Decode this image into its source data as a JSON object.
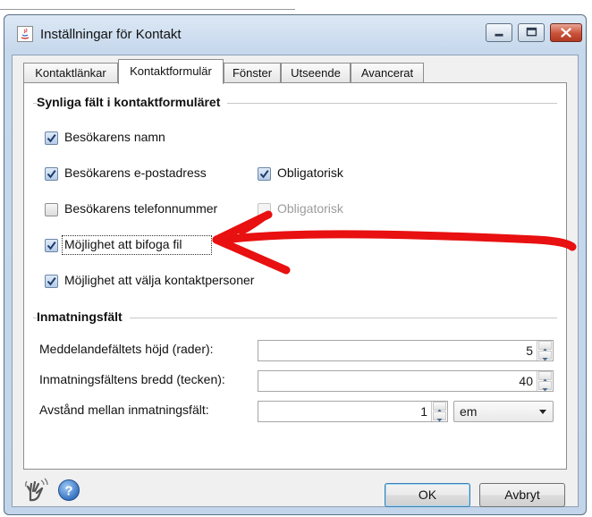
{
  "window": {
    "title": "Inställningar för Kontakt"
  },
  "tabs": [
    {
      "label": "Kontaktlänkar",
      "active": false
    },
    {
      "label": "Kontaktformulär",
      "active": true
    },
    {
      "label": "Fönster",
      "active": false
    },
    {
      "label": "Utseende",
      "active": false
    },
    {
      "label": "Avancerat",
      "active": false
    }
  ],
  "visible_fields": {
    "title": "Synliga fält i kontaktformuläret",
    "items": [
      {
        "label": "Besökarens namn",
        "checked": true
      },
      {
        "label": "Besökarens e-postadress",
        "checked": true,
        "required_label": "Obligatorisk",
        "required_checked": true,
        "required_enabled": true
      },
      {
        "label": "Besökarens telefonnummer",
        "checked": false,
        "required_label": "Obligatorisk",
        "required_checked": false,
        "required_enabled": false
      },
      {
        "label": "Möjlighet att bifoga fil",
        "checked": true,
        "focused": true
      },
      {
        "label": "Möjlighet att välja kontaktpersoner",
        "checked": true
      }
    ]
  },
  "input_fields": {
    "title": "Inmatningsfält",
    "message_height": {
      "label": "Meddelandefältets höjd (rader):",
      "value": "5"
    },
    "field_width": {
      "label": "Inmatningsfältens bredd (tecken):",
      "value": "40"
    },
    "spacing": {
      "label": "Avstånd mellan inmatningsfält:",
      "value": "1",
      "unit": "em"
    }
  },
  "footer": {
    "ok_label": "OK",
    "cancel_label": "Avbryt",
    "left_icon": "hand-wave-icon",
    "help_icon": "help-icon"
  },
  "annotation": {
    "color": "#e81010",
    "shape": "arrow-pointing-left"
  }
}
